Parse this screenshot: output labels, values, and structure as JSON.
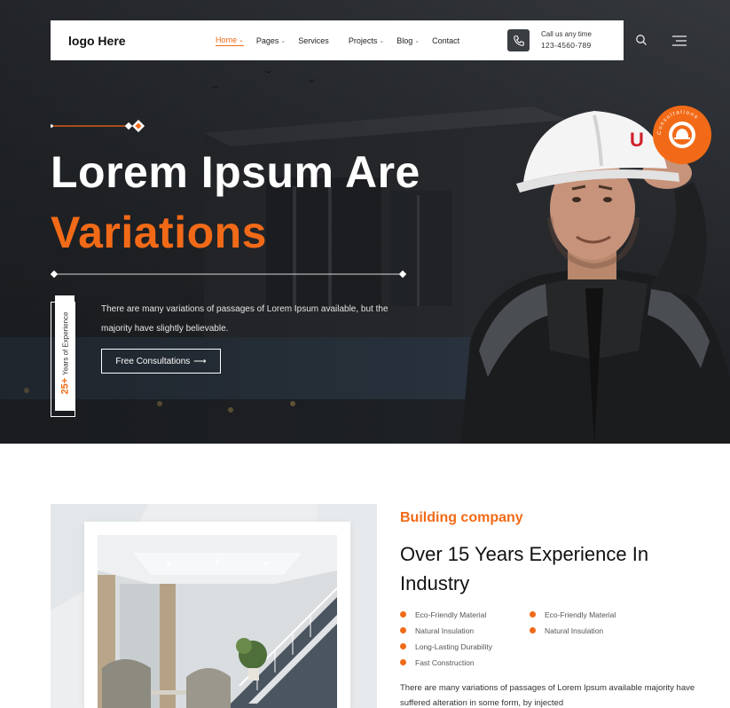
{
  "colors": {
    "accent": "#f26a17",
    "dark": "#1d2024",
    "white": "#ffffff"
  },
  "navbar": {
    "logo": "logo Here",
    "items": [
      {
        "label": "Home",
        "has_dropdown": true,
        "active": true
      },
      {
        "label": "Pages",
        "has_dropdown": true
      },
      {
        "label": "Services",
        "has_dropdown": false
      },
      {
        "label": "Projects",
        "has_dropdown": true
      },
      {
        "label": "Blog",
        "has_dropdown": true
      },
      {
        "label": "Contact",
        "has_dropdown": false
      }
    ],
    "call_label": "Call us any time",
    "call_number": "123-4560-789",
    "icons": [
      "phone-icon",
      "search-icon",
      "menu-icon"
    ]
  },
  "hero": {
    "title_line1": "Lorem Ipsum Are",
    "title_line2": "Variations",
    "description": "There are many variations of passages of Lorem Ipsum available, but the majority have slightly believable.",
    "cta_label": "Free Consultations",
    "cta_arrow": "⟶",
    "experience_number": "25+",
    "experience_label": "Years of Experience"
  },
  "about": {
    "eyebrow": "Building company",
    "title": "Over 15 Years Experience In Industry",
    "features": [
      "Eco-Friendly Material",
      "Eco-Friendly Material",
      "Natural Insulation",
      "Natural Insulation",
      "Long-Lasting Durability",
      "",
      "Fast Construction",
      ""
    ],
    "description": "There are many variations of passages of Lorem Ipsum available majority have suffered alteration in some form, by injected"
  }
}
